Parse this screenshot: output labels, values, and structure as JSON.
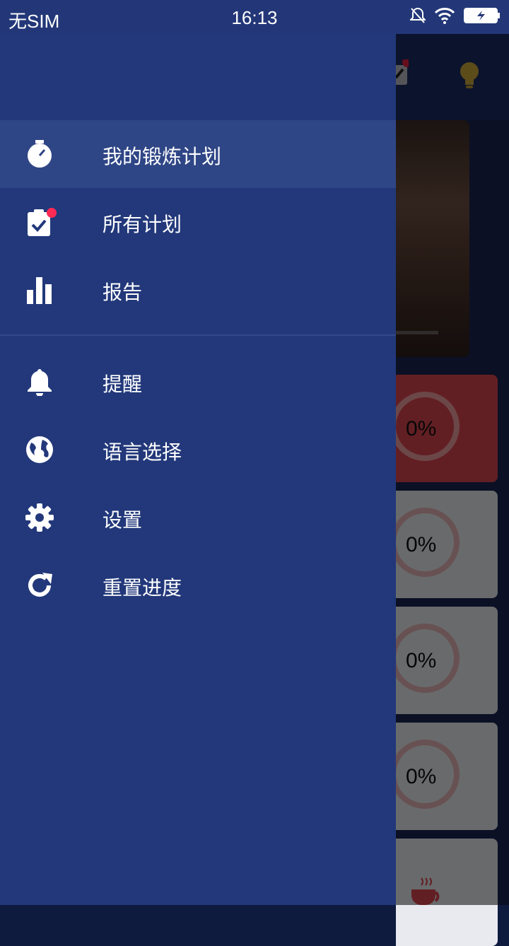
{
  "status_bar": {
    "carrier": "无SIM",
    "time": "16:13"
  },
  "drawer": {
    "primary_items": [
      {
        "label": "我的锻炼计划",
        "icon": "stopwatch-icon",
        "active": true
      },
      {
        "label": "所有计划",
        "icon": "clipboard-check-icon",
        "badge": true
      },
      {
        "label": "报告",
        "icon": "bar-chart-icon"
      }
    ],
    "secondary_items": [
      {
        "label": "提醒",
        "icon": "bell-icon"
      },
      {
        "label": "语言选择",
        "icon": "globe-icon"
      },
      {
        "label": "设置",
        "icon": "gear-icon"
      },
      {
        "label": "重置进度",
        "icon": "refresh-icon"
      }
    ]
  },
  "background": {
    "cards": [
      {
        "progress_text": "0%"
      },
      {
        "progress_text": "0%"
      },
      {
        "progress_text": "0%"
      },
      {
        "progress_text": "0%"
      }
    ]
  },
  "colors": {
    "drawer_bg": "#22387a",
    "active_item_bg": "#2f4686",
    "status_bar_bg": "#233778",
    "badge": "#ff2b55",
    "card_accent": "#d9454e"
  }
}
